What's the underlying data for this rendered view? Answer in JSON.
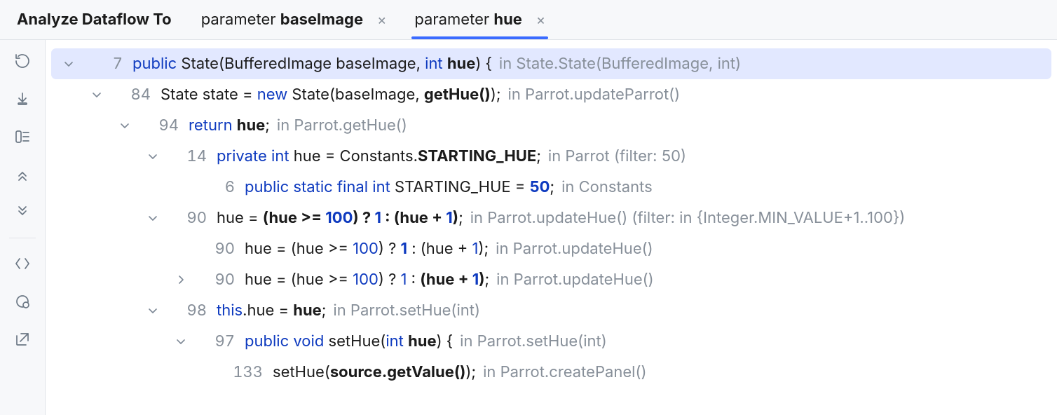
{
  "title": "Analyze Dataflow To",
  "tabs": [
    {
      "kind": "parameter",
      "name": "baseImage",
      "active": false
    },
    {
      "kind": "parameter",
      "name": "hue",
      "active": true
    }
  ],
  "colors": {
    "keyword": "#0e3abf",
    "selection": "#e2e8ff",
    "accent": "#3a6bff",
    "muted": "#878f99"
  },
  "tree": [
    {
      "indent": 0,
      "disclosure": "down",
      "selected": true,
      "line": 7,
      "segments": [
        {
          "t": "public ",
          "cls": "kw"
        },
        {
          "t": "State(BufferedImage baseImage, "
        },
        {
          "t": "int ",
          "cls": "kw"
        },
        {
          "t": "hue",
          "cls": "b"
        },
        {
          "t": ") {"
        }
      ],
      "location": "in State.State(BufferedImage, int)"
    },
    {
      "indent": 1,
      "disclosure": "down",
      "line": 84,
      "segments": [
        {
          "t": "State state = "
        },
        {
          "t": "new ",
          "cls": "kw"
        },
        {
          "t": "State(baseImage, "
        },
        {
          "t": "getHue()",
          "cls": "b"
        },
        {
          "t": ");"
        }
      ],
      "location": "in Parrot.updateParrot()"
    },
    {
      "indent": 2,
      "disclosure": "down",
      "line": 94,
      "segments": [
        {
          "t": "return ",
          "cls": "kw"
        },
        {
          "t": "hue",
          "cls": "b"
        },
        {
          "t": ";"
        }
      ],
      "location": "in Parrot.getHue()"
    },
    {
      "indent": 3,
      "disclosure": "down",
      "line": 14,
      "segments": [
        {
          "t": "private int ",
          "cls": "kw"
        },
        {
          "t": "hue = Constants."
        },
        {
          "t": "STARTING_HUE",
          "cls": "b"
        },
        {
          "t": ";"
        }
      ],
      "location": "in Parrot (filter: 50)"
    },
    {
      "indent": 4,
      "disclosure": "none",
      "line": 6,
      "segments": [
        {
          "t": "public static final int ",
          "cls": "kw"
        },
        {
          "t": "STARTING_HUE = "
        },
        {
          "t": "50",
          "cls": "kw b"
        },
        {
          "t": ";"
        }
      ],
      "location": "in Constants"
    },
    {
      "indent": 3,
      "disclosure": "down",
      "line": 90,
      "segments": [
        {
          "t": "hue = "
        },
        {
          "t": "(hue >= ",
          "cls": "b"
        },
        {
          "t": "100",
          "cls": "kw b"
        },
        {
          "t": ") ? ",
          "cls": "b"
        },
        {
          "t": "1",
          "cls": "kw b"
        },
        {
          "t": " : (hue + ",
          "cls": "b"
        },
        {
          "t": "1",
          "cls": "kw b"
        },
        {
          "t": ")",
          "cls": "b"
        },
        {
          "t": ";"
        }
      ],
      "location": "in Parrot.updateHue() (filter: in {Integer.MIN_VALUE+1..100})"
    },
    {
      "indent": 4,
      "disclosure": "none",
      "line": 90,
      "segments": [
        {
          "t": "hue = (hue >= "
        },
        {
          "t": "100",
          "cls": "kw"
        },
        {
          "t": ") ? "
        },
        {
          "t": "1",
          "cls": "kw b"
        },
        {
          "t": " : (hue + "
        },
        {
          "t": "1",
          "cls": "kw"
        },
        {
          "t": ");"
        }
      ],
      "location": "in Parrot.updateHue()"
    },
    {
      "indent": 4,
      "disclosure": "right",
      "line": 90,
      "segments": [
        {
          "t": "hue = (hue >= "
        },
        {
          "t": "100",
          "cls": "kw"
        },
        {
          "t": ") ? "
        },
        {
          "t": "1",
          "cls": "kw"
        },
        {
          "t": " : "
        },
        {
          "t": "(hue + ",
          "cls": "b"
        },
        {
          "t": "1",
          "cls": "kw b"
        },
        {
          "t": ")",
          "cls": "b"
        },
        {
          "t": ";"
        }
      ],
      "location": "in Parrot.updateHue()"
    },
    {
      "indent": 3,
      "disclosure": "down",
      "line": 98,
      "segments": [
        {
          "t": "this",
          "cls": "kw"
        },
        {
          "t": ".hue = "
        },
        {
          "t": "hue",
          "cls": "b"
        },
        {
          "t": ";"
        }
      ],
      "location": "in Parrot.setHue(int)"
    },
    {
      "indent": 4,
      "disclosure": "down",
      "line": 97,
      "segments": [
        {
          "t": "public void ",
          "cls": "kw"
        },
        {
          "t": "setHue("
        },
        {
          "t": "int ",
          "cls": "kw"
        },
        {
          "t": "hue",
          "cls": "b"
        },
        {
          "t": ") {"
        }
      ],
      "location": "in Parrot.setHue(int)"
    },
    {
      "indent": 5,
      "disclosure": "none",
      "line": 133,
      "segments": [
        {
          "t": "setHue("
        },
        {
          "t": "source.getValue()",
          "cls": "b"
        },
        {
          "t": ");"
        }
      ],
      "location": "in Parrot.createPanel()"
    }
  ],
  "sidebar_icons": [
    "rerun",
    "flatten",
    "group",
    "prev",
    "next",
    "preview",
    "breakpoints",
    "open-external"
  ]
}
